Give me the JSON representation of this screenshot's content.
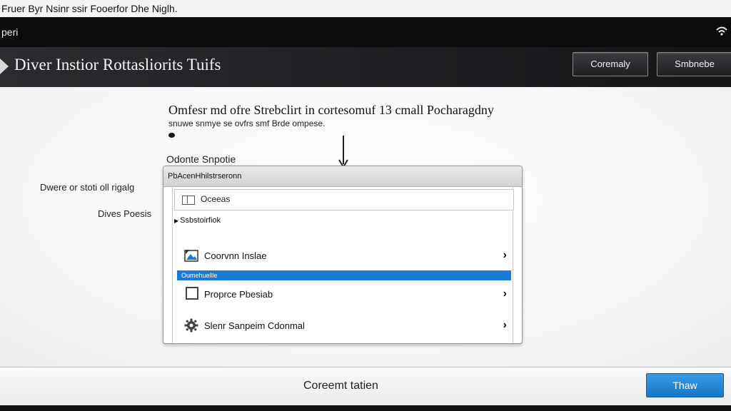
{
  "window": {
    "title": "Fruer Byr Nsinr ssir Fooerfor Dhe Niglh."
  },
  "menubar": {
    "label": "peri",
    "status_icon": "wifi-icon"
  },
  "header": {
    "app_icon": "app-icon",
    "title": "Diver Instior Rottasliorits Tuifs",
    "button1_label": "Coremaly",
    "button2_label": "Smbnebe"
  },
  "content": {
    "description_line1": "Omfesr md ofre Strebclirt in cortesomuf 13 cmall Pocharagdny",
    "description_line2": "snuwe snmye se ovfrs smf Brde ompese.",
    "options_label": "Odonte Snpotie",
    "left_label1": "Dwere or stoti oll rigalg",
    "left_label2": "Dives Poesis"
  },
  "panel": {
    "header": "PbAcenHhilstrseronn",
    "search_value": "Oceeas",
    "section_label": "Ssbstoirfiok",
    "items": [
      {
        "label": "Coorvnn Inslae",
        "icon": "image-icon"
      },
      {
        "label": "Proprce Pbesiab",
        "icon": "checkbox-icon"
      },
      {
        "label": "Slenr Sanpeim Cdonmal",
        "icon": "gear-icon"
      }
    ],
    "highlight_text": "Oumehuellle"
  },
  "footer": {
    "label": "Coreemt tatien",
    "primary_button": "Thaw"
  },
  "colors": {
    "accent": "#1a7bd4",
    "header_bg": "#1d1f22",
    "menubar_bg": "#0c0c0c"
  }
}
